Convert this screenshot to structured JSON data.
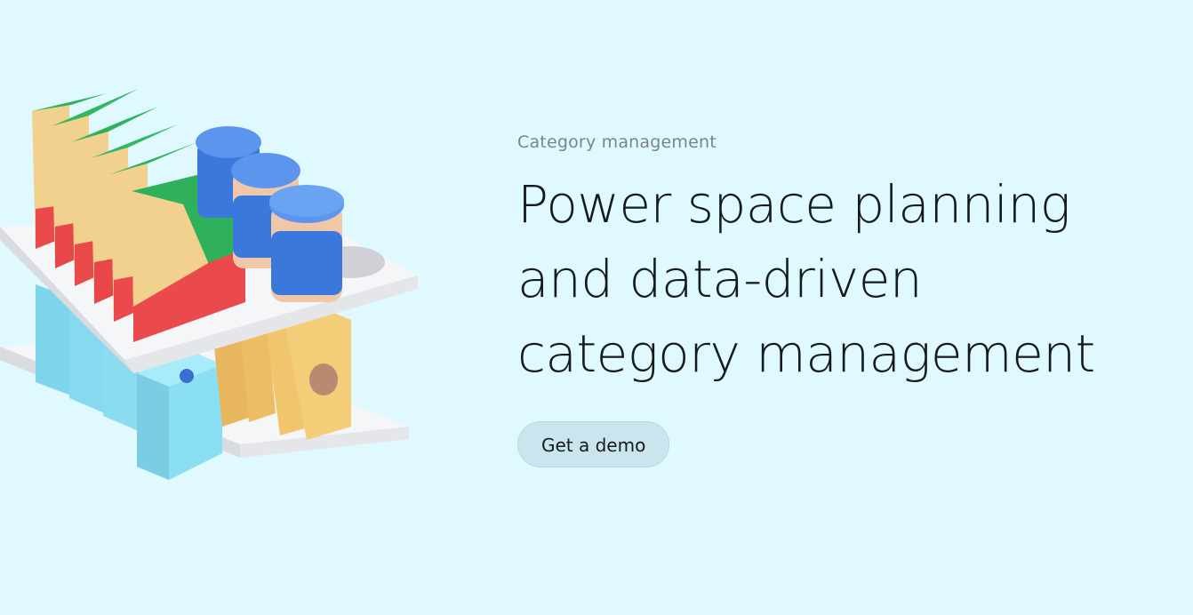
{
  "hero": {
    "eyebrow": "Category management",
    "headline_lines": [
      "Power space planning",
      "and data-driven",
      "category management"
    ],
    "cta_label": "Get a demo"
  },
  "illustration": {
    "icon": "shelf-with-products-illustration"
  },
  "colors": {
    "background": "#e0f9fe",
    "headline": "#151a1c",
    "eyebrow": "#7a8589",
    "cta_background": "#cbe5ee",
    "box_beige": "#f2d08e",
    "box_green": "#2fb15c",
    "box_red": "#ea4a4c",
    "jar_blue": "#3a78dc",
    "carton_blue": "#8adff2",
    "bag_yellow": "#f0c56d"
  }
}
